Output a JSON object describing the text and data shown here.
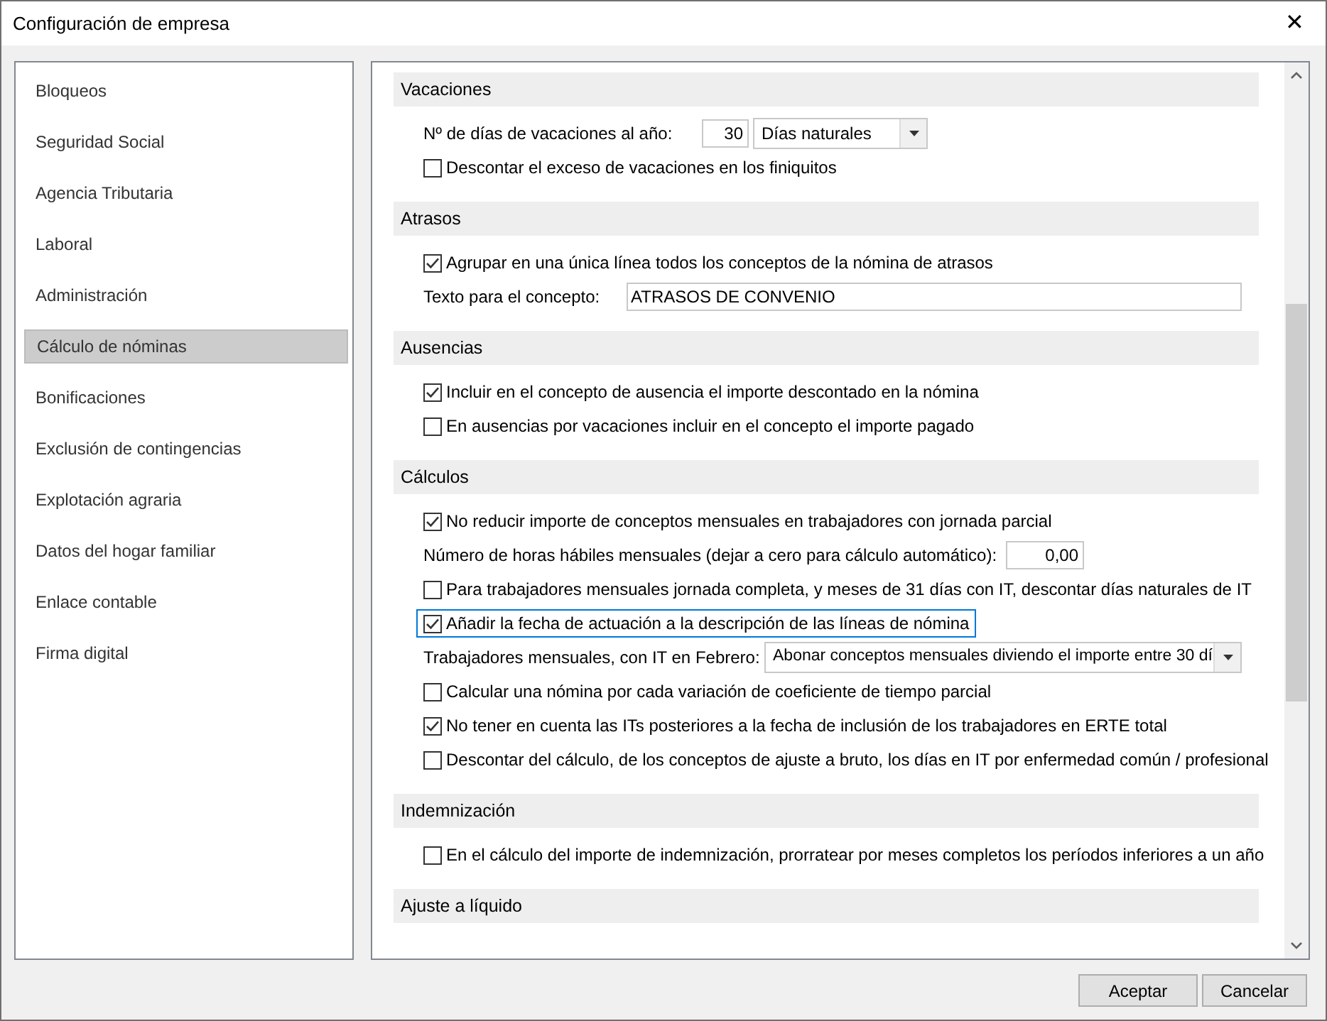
{
  "window": {
    "title": "Configuración de empresa",
    "close": "✕"
  },
  "sidebar": {
    "items": [
      {
        "label": "Bloqueos",
        "selected": false
      },
      {
        "label": "Seguridad Social",
        "selected": false
      },
      {
        "label": "Agencia Tributaria",
        "selected": false
      },
      {
        "label": "Laboral",
        "selected": false
      },
      {
        "label": "Administración",
        "selected": false
      },
      {
        "label": "Cálculo de nóminas",
        "selected": true
      },
      {
        "label": "Bonificaciones",
        "selected": false
      },
      {
        "label": "Exclusión de contingencias",
        "selected": false
      },
      {
        "label": "Explotación agraria",
        "selected": false
      },
      {
        "label": "Datos del hogar familiar",
        "selected": false
      },
      {
        "label": "Enlace contable",
        "selected": false
      },
      {
        "label": "Firma digital",
        "selected": false
      }
    ]
  },
  "sections": [
    {
      "title": "Vacaciones",
      "rows": [
        {
          "kind": "days",
          "label": "Nº de días de vacaciones al año:",
          "value": "30",
          "select": "Días naturales"
        },
        {
          "kind": "checkbox",
          "label": "Descontar el exceso de vacaciones en los finiquitos",
          "checked": false,
          "focused": false
        }
      ]
    },
    {
      "title": "Atrasos",
      "rows": [
        {
          "kind": "checkbox",
          "label": "Agrupar en una única línea todos los conceptos de la nómina de atrasos",
          "checked": true,
          "focused": false
        },
        {
          "kind": "text",
          "label": "Texto para el concepto:",
          "value": "ATRASOS DE CONVENIO"
        }
      ]
    },
    {
      "title": "Ausencias",
      "rows": [
        {
          "kind": "checkbox",
          "label": "Incluir en el concepto de ausencia el importe descontado en la nómina",
          "checked": true,
          "focused": false
        },
        {
          "kind": "checkbox",
          "label": "En ausencias por vacaciones incluir en el concepto el importe pagado",
          "checked": false,
          "focused": false
        }
      ]
    },
    {
      "title": "Cálculos",
      "rows": [
        {
          "kind": "checkbox",
          "label": "No reducir importe de conceptos mensuales en trabajadores con jornada parcial",
          "checked": true,
          "focused": false
        },
        {
          "kind": "hours",
          "label": "Número de horas hábiles mensuales (dejar a cero para cálculo automático):",
          "value": "0,00"
        },
        {
          "kind": "checkbox",
          "label": "Para trabajadores mensuales jornada completa, y meses de 31 días con IT, descontar días naturales de IT",
          "checked": false,
          "focused": false
        },
        {
          "kind": "checkbox",
          "label": "Añadir la fecha de actuación a la descripción de las líneas de nómina",
          "checked": true,
          "focused": true
        },
        {
          "kind": "select",
          "label": "Trabajadores mensuales, con IT en Febrero:",
          "select": "Abonar conceptos mensuales diviendo el importe entre 30 dí"
        },
        {
          "kind": "checkbox",
          "label": "Calcular una nómina por cada variación de coeficiente de tiempo parcial",
          "checked": false,
          "focused": false
        },
        {
          "kind": "checkbox",
          "label": "No tener en cuenta las ITs posteriores a la fecha de inclusión de los trabajadores en ERTE total",
          "checked": true,
          "focused": false
        },
        {
          "kind": "checkbox",
          "label": "Descontar del cálculo, de los conceptos de ajuste a bruto, los días en IT por enfermedad común / profesional",
          "checked": false,
          "focused": false
        }
      ]
    },
    {
      "title": "Indemnización",
      "rows": [
        {
          "kind": "checkbox",
          "label": "En el cálculo del importe de indemnización, prorratear por meses completos los períodos inferiores a un año",
          "checked": false,
          "focused": false
        }
      ]
    },
    {
      "title": "Ajuste a líquido"
    }
  ],
  "buttons": [
    "Aceptar",
    "Cancelar"
  ]
}
